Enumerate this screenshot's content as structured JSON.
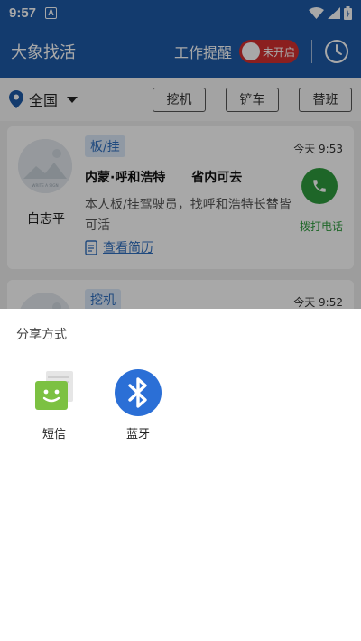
{
  "status_bar": {
    "time": "9:57",
    "notification_badge": "A",
    "icons": [
      "wifi-icon",
      "signal-icon",
      "battery-icon"
    ]
  },
  "app_bar": {
    "title": "大象找活",
    "reminder_label": "工作提醒",
    "toggle_text": "未开启",
    "accent_color": "#1d5aa8",
    "toggle_color": "#d32f2f"
  },
  "filter_bar": {
    "location": "全国",
    "chips": [
      "挖机",
      "铲车",
      "替班"
    ]
  },
  "job_list": {
    "items": [
      {
        "avatar_caption": "WRITE A SIGN",
        "name": "白志平",
        "tag": "板/挂",
        "time": "今天 9:53",
        "location": "内蒙·呼和浩特",
        "scope": "省内可去",
        "description": "本人板/挂驾驶员，找呼和浩特长替皆可活",
        "resume_link": "查看简历",
        "call_label": "拨打电话"
      },
      {
        "tag": "挖机",
        "time": "今天 9:52"
      }
    ]
  },
  "share_sheet": {
    "title": "分享方式",
    "options": [
      {
        "label": "短信",
        "icon": "sms-icon"
      },
      {
        "label": "蓝牙",
        "icon": "bluetooth-icon"
      }
    ]
  },
  "colors": {
    "tag_bg": "#dbe9f9",
    "tag_text": "#2f6fc0",
    "call_green": "#2e9c3e",
    "bluetooth_blue": "#2b6fd6"
  }
}
